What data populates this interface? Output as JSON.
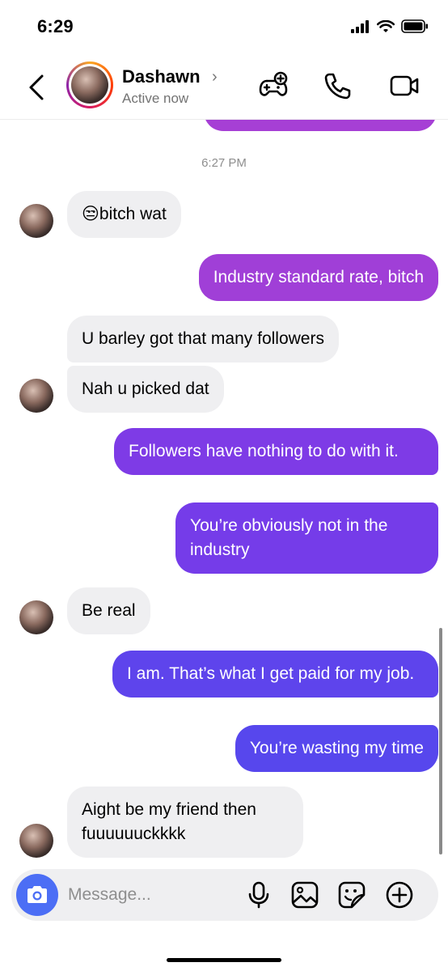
{
  "status_bar": {
    "time": "6:29",
    "icons": [
      "signal-icon",
      "wifi-icon",
      "battery-icon"
    ]
  },
  "header": {
    "back_icon": "chevron-left-icon",
    "contact_name": "Dashawn",
    "name_chevron": "›",
    "status": "Active now",
    "actions": [
      "games-icon",
      "phone-icon",
      "video-icon"
    ]
  },
  "chat": {
    "timestamp": "6:27 PM",
    "messages": [
      {
        "from": "them",
        "emoji": "😒",
        "text": "bitch wat"
      },
      {
        "from": "me",
        "text": "Industry standard rate, bitch"
      },
      {
        "from": "them",
        "text": "U barley got that many followers"
      },
      {
        "from": "them",
        "text": "Nah u picked dat"
      },
      {
        "from": "me",
        "text": "Followers have nothing to do with it."
      },
      {
        "from": "me",
        "text": "You’re obviously not in the industry"
      },
      {
        "from": "them",
        "text": "Be real"
      },
      {
        "from": "me",
        "text": "I am. That’s what I get paid for my job."
      },
      {
        "from": "me",
        "text": "You’re wasting my time"
      },
      {
        "from": "them",
        "text": "Aight be my friend then fuuuuuuckkkk"
      }
    ]
  },
  "composer": {
    "placeholder": "Message...",
    "icons": [
      "camera-icon",
      "microphone-icon",
      "gallery-icon",
      "sticker-icon",
      "plus-circle-icon"
    ]
  },
  "colors": {
    "accent_top": "#a13fd6",
    "accent_bottom": "#5b4bec",
    "bubble_them": "#efeff1",
    "camera_button": "#4c6ef5"
  }
}
